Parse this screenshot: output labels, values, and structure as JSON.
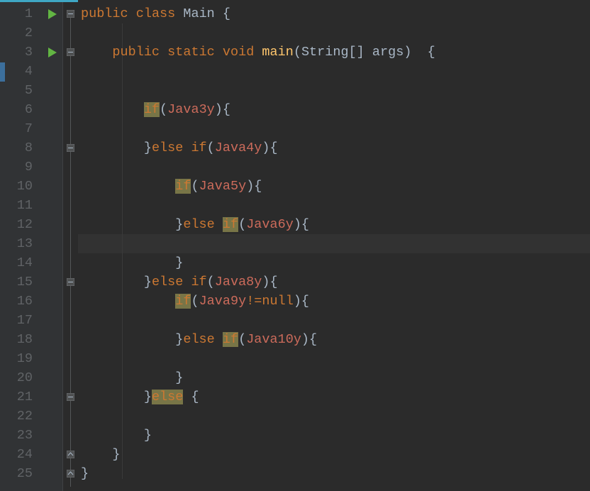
{
  "line_count": 25,
  "current_line": 13,
  "run_markers": [
    1,
    3
  ],
  "fold_markers": {
    "1": "open-down",
    "3": "open-down",
    "8": "open-down",
    "15": "open-down",
    "21": "open-down",
    "24": "open-up",
    "25": "open-up"
  },
  "tokens": {
    "kw_public": "public",
    "kw_class": "class",
    "kw_static": "static",
    "kw_void": "void",
    "kw_if": "if",
    "kw_else": "else",
    "kw_null": "null",
    "kw_else_if": "else if",
    "cls_Main": "Main",
    "cls_String": "String",
    "fn_main": "main",
    "id_args": "args",
    "v_Java3y": "Java3y",
    "v_Java4y": "Java4y",
    "v_Java5y": "Java5y",
    "v_Java6y": "Java6y",
    "v_Java8y": "Java8y",
    "v_Java9y": "Java9y",
    "v_Java10y": "Java10y",
    "op_neq": "!="
  }
}
